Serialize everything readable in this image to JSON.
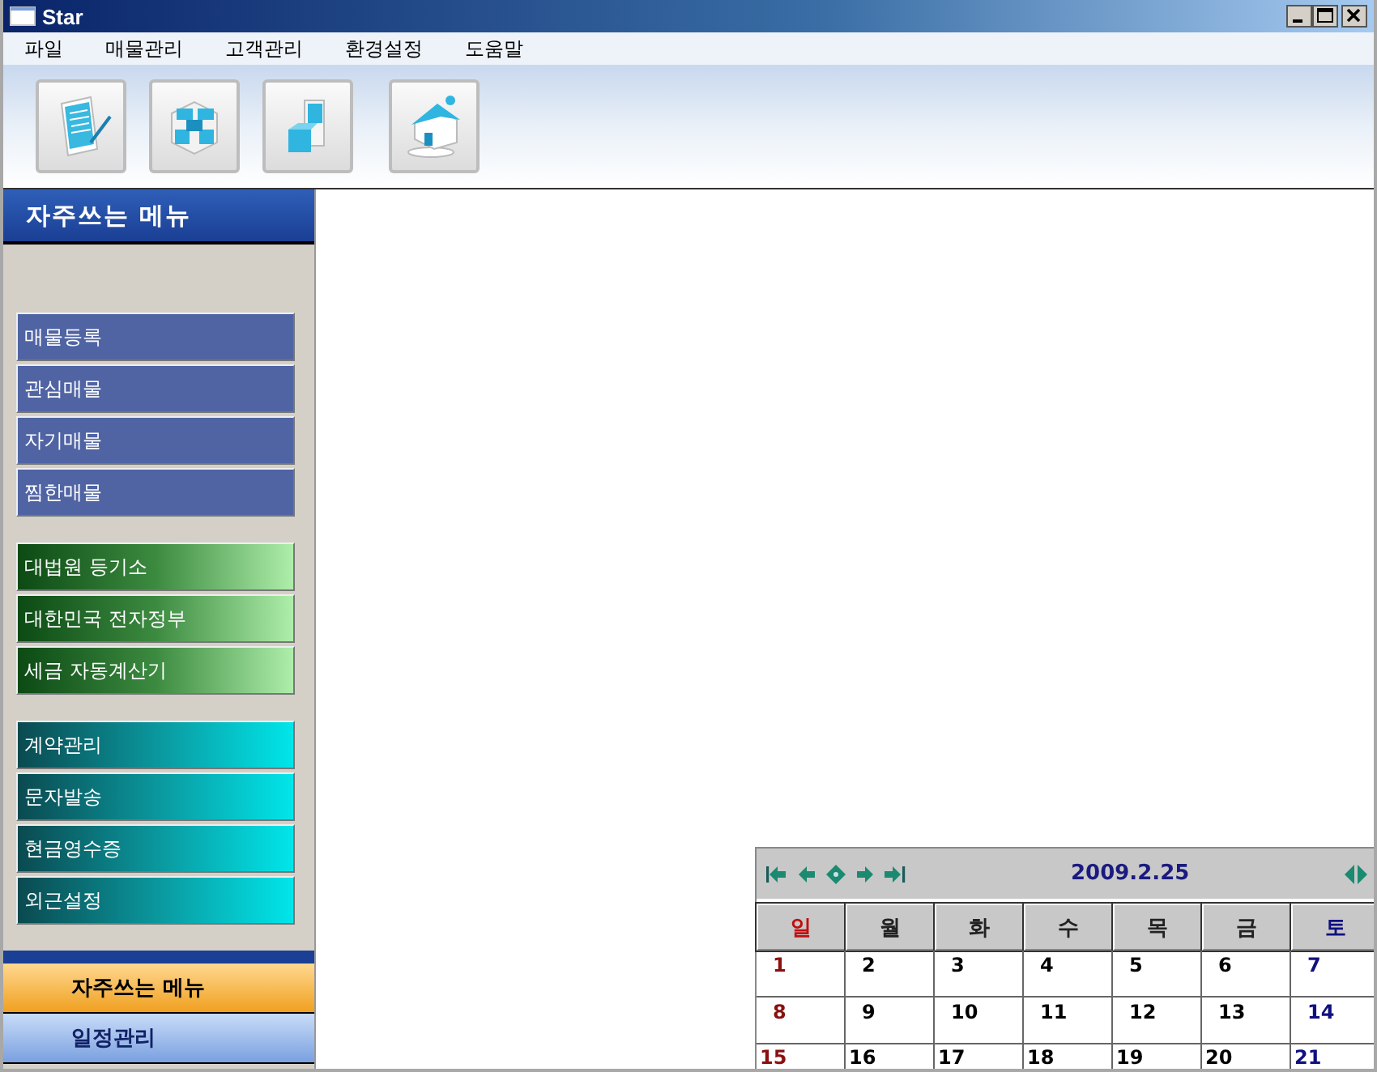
{
  "window": {
    "title": "Star"
  },
  "menu": [
    "파일",
    "매물관리",
    "고객관리",
    "환경설정",
    "도움말"
  ],
  "toolbar": [
    {
      "kind": "document"
    },
    {
      "kind": "cubes"
    },
    {
      "kind": "blocks"
    },
    {
      "kind": "house"
    }
  ],
  "sidebar": {
    "header": "자주쓰는 메뉴",
    "groups": [
      {
        "kind": "blue",
        "items": [
          "매물등록",
          "관심매물",
          "자기매물",
          "찜한매물"
        ]
      },
      {
        "kind": "green",
        "items": [
          "대법원 등기소",
          "대한민국 전자정부",
          "세금 자동계산기"
        ]
      },
      {
        "kind": "teal",
        "items": [
          "계약관리",
          "문자발송",
          "현금영수증",
          "외근설정"
        ]
      }
    ],
    "tabs": [
      {
        "label": "자주쓰는 메뉴",
        "selected": true
      },
      {
        "label": "일정관리",
        "selected": false
      }
    ]
  },
  "calendar": {
    "date": "2009.2.25",
    "weekdays": [
      "일",
      "월",
      "화",
      "수",
      "목",
      "금",
      "토"
    ],
    "weeks": [
      [
        "1",
        "2",
        "3",
        "4",
        "5",
        "6",
        "7"
      ],
      [
        "8",
        "9",
        "10",
        "11",
        "12",
        "13",
        "14"
      ],
      [
        "15",
        "16",
        "17",
        "18",
        "19",
        "20",
        "21"
      ]
    ]
  }
}
